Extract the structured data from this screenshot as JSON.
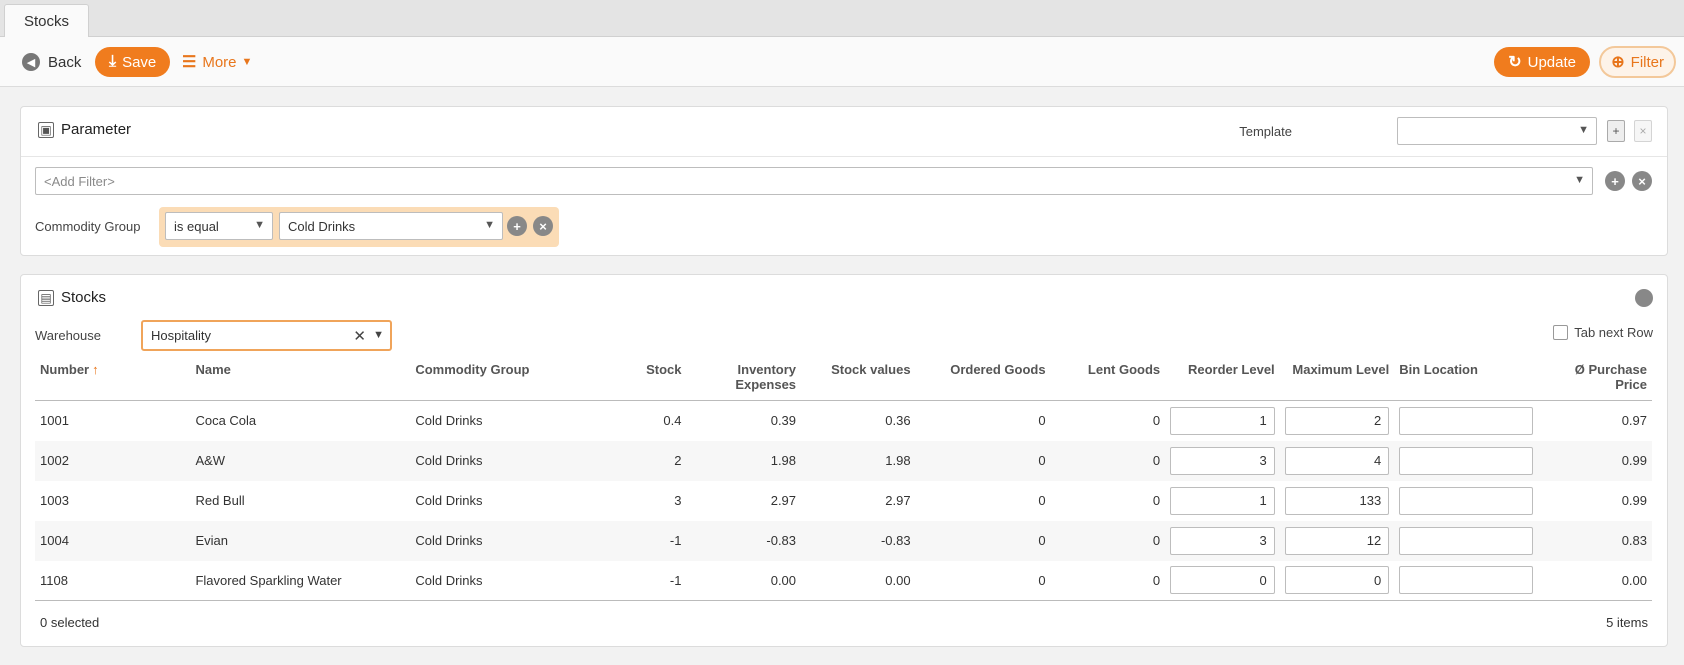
{
  "tab": {
    "label": "Stocks"
  },
  "toolbar": {
    "back_label": "Back",
    "save_label": "Save",
    "more_label": "More",
    "update_label": "Update",
    "filter_label": "Filter"
  },
  "parameter": {
    "title": "Parameter",
    "template_label": "Template",
    "template_value": "",
    "add_filter_placeholder": "<Add Filter>",
    "filter": {
      "field_label": "Commodity Group",
      "operator": "is equal",
      "value": "Cold Drinks"
    }
  },
  "stocks": {
    "title": "Stocks",
    "warehouse_label": "Warehouse",
    "warehouse_value": "Hospitality",
    "tab_next_row_label": "Tab next Row",
    "columns": [
      "Number",
      "Name",
      "Commodity Group",
      "Stock",
      "Inventory Expenses",
      "Stock values",
      "Ordered Goods",
      "Lent Goods",
      "Reorder Level",
      "Maximum Level",
      "Bin Location",
      "Ø Purchase Price"
    ],
    "rows": [
      {
        "number": "1001",
        "name": "Coca Cola",
        "group": "Cold Drinks",
        "stock": "0.4",
        "inv_exp": "0.39",
        "stock_values": "0.36",
        "ordered": "0",
        "lent": "0",
        "reorder": "1",
        "max": "2",
        "bin": "",
        "price": "0.97"
      },
      {
        "number": "1002",
        "name": "A&W",
        "group": "Cold Drinks",
        "stock": "2",
        "inv_exp": "1.98",
        "stock_values": "1.98",
        "ordered": "0",
        "lent": "0",
        "reorder": "3",
        "max": "4",
        "bin": "",
        "price": "0.99"
      },
      {
        "number": "1003",
        "name": "Red Bull",
        "group": "Cold Drinks",
        "stock": "3",
        "inv_exp": "2.97",
        "stock_values": "2.97",
        "ordered": "0",
        "lent": "0",
        "reorder": "1",
        "max": "133",
        "bin": "",
        "price": "0.99"
      },
      {
        "number": "1004",
        "name": "Evian",
        "group": "Cold Drinks",
        "stock": "-1",
        "inv_exp": "-0.83",
        "stock_values": "-0.83",
        "ordered": "0",
        "lent": "0",
        "reorder": "3",
        "max": "12",
        "bin": "",
        "price": "0.83"
      },
      {
        "number": "1108",
        "name": "Flavored Sparkling Water",
        "group": "Cold Drinks",
        "stock": "-1",
        "inv_exp": "0.00",
        "stock_values": "0.00",
        "ordered": "0",
        "lent": "0",
        "reorder": "0",
        "max": "0",
        "bin": "",
        "price": "0.00"
      }
    ],
    "selected_text": "0 selected",
    "items_text": "5 items"
  },
  "colors": {
    "accent": "#f07c1e",
    "filter_highlight": "#fbdcb6"
  }
}
